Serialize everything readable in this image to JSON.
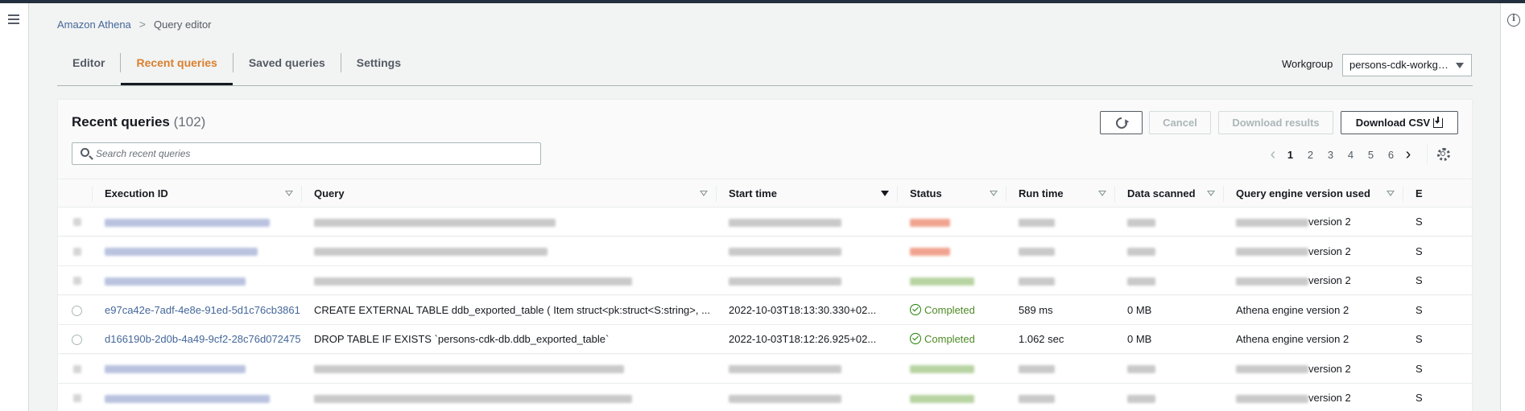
{
  "breadcrumb": {
    "root": "Amazon Athena",
    "current": "Query editor"
  },
  "tabs": [
    {
      "label": "Editor",
      "active": false
    },
    {
      "label": "Recent queries",
      "active": true
    },
    {
      "label": "Saved queries",
      "active": false
    },
    {
      "label": "Settings",
      "active": false
    }
  ],
  "workgroup": {
    "label": "Workgroup",
    "value": "persons-cdk-workg…"
  },
  "panel": {
    "title": "Recent queries",
    "count": "(102)",
    "search_placeholder": "Search recent queries",
    "buttons": {
      "cancel": "Cancel",
      "download_results": "Download results",
      "download_csv": "Download CSV"
    },
    "pagination": {
      "current": 1,
      "pages": [
        "1",
        "2",
        "3",
        "4",
        "5",
        "6"
      ]
    }
  },
  "table": {
    "columns": [
      "Execution ID",
      "Query",
      "Start time",
      "Status",
      "Run time",
      "Data scanned",
      "Query engine version used",
      "E"
    ],
    "sorted_column": "Start time",
    "rows": [
      {
        "redacted": true,
        "status_color": "red",
        "engine_suffix": "version 2",
        "last": "S"
      },
      {
        "redacted": true,
        "status_color": "red",
        "engine_suffix": "version 2",
        "last": "S"
      },
      {
        "redacted": true,
        "status_color": "green",
        "engine_suffix": "version 2",
        "last": "S"
      },
      {
        "redacted": false,
        "execution_id": "e97ca42e-7adf-4e8e-91ed-5d1c76cb3861",
        "query": "CREATE EXTERNAL TABLE ddb_exported_table ( Item struct<pk:struct<S:string>, ...",
        "start_time": "2022-10-03T18:13:30.330+02...",
        "status": "Completed",
        "run_time": "589 ms",
        "data_scanned": "0 MB",
        "engine": "Athena engine version 2",
        "last": "S"
      },
      {
        "redacted": false,
        "execution_id": "d166190b-2d0b-4a49-9cf2-28c76d072475",
        "query": "DROP TABLE IF EXISTS `persons-cdk-db.ddb_exported_table`",
        "start_time": "2022-10-03T18:12:26.925+02...",
        "status": "Completed",
        "run_time": "1.062 sec",
        "data_scanned": "0 MB",
        "engine": "Athena engine version 2",
        "last": "S"
      },
      {
        "redacted": true,
        "status_color": "green",
        "engine_suffix": "version 2",
        "last": "S"
      },
      {
        "redacted": true,
        "status_color": "green",
        "engine_suffix": "version 2",
        "last": "S"
      }
    ]
  }
}
